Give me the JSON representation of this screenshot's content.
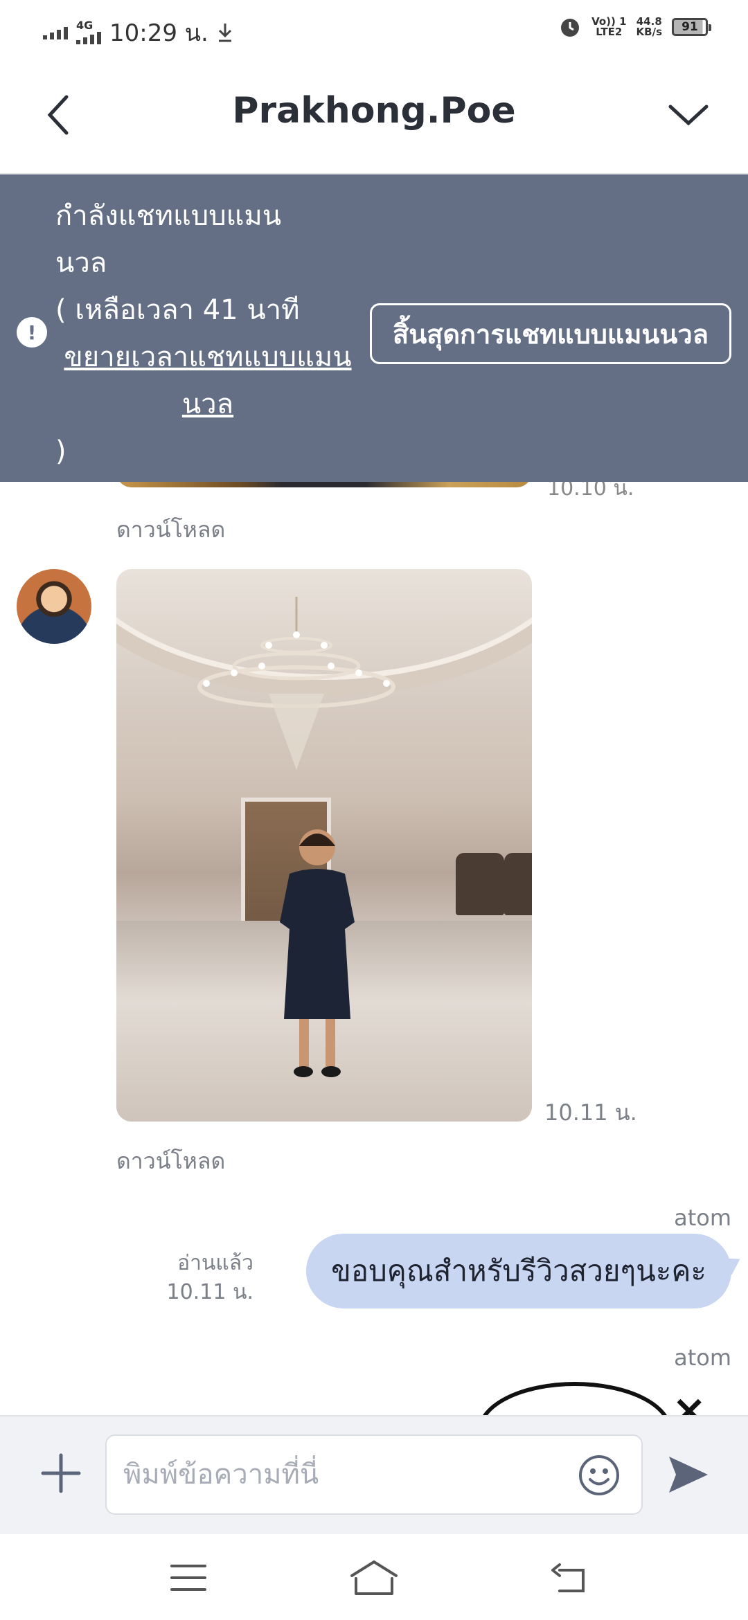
{
  "status_bar": {
    "network": "4G",
    "time": "10:29 น.",
    "volte": [
      "Vo)) 1",
      "LTE2"
    ],
    "speed": [
      "44.8",
      "KB/s"
    ],
    "battery": "91",
    "icons": [
      "signal-icon",
      "download-icon",
      "alarm-icon"
    ]
  },
  "header": {
    "title": "Prakhong.Poe",
    "back_icon": "chevron-left-icon",
    "menu_icon": "chevron-down-icon"
  },
  "banner": {
    "line1": "กำลังแชทแบบแมน",
    "line2": "นวล",
    "line3": "( เหลือเวลา 41 นาที",
    "extend_link": "ขยายเวลาแชทแบบแมน",
    "extend_link2": "นวล",
    "line_close": ")",
    "end_button": "สิ้นสุดการแชทแบบแมนนวล",
    "bg_color": "#646f86"
  },
  "chat": {
    "prev_time": "10.10 น.",
    "download_1": "ดาวน์โหลด",
    "photo_time": "10.11 น.",
    "download_2": "ดาวน์โหลด",
    "sender_1": "atom",
    "read_status": "อ่านแล้ว",
    "read_time": "10.11 น.",
    "message_1": "ขอบคุณสำหรับรีวิวสวยๆนะคะ",
    "sender_2": "atom",
    "bubble_color": "#c9d6f2"
  },
  "input": {
    "placeholder": "พิมพ์ข้อความที่นี่",
    "value": ""
  }
}
